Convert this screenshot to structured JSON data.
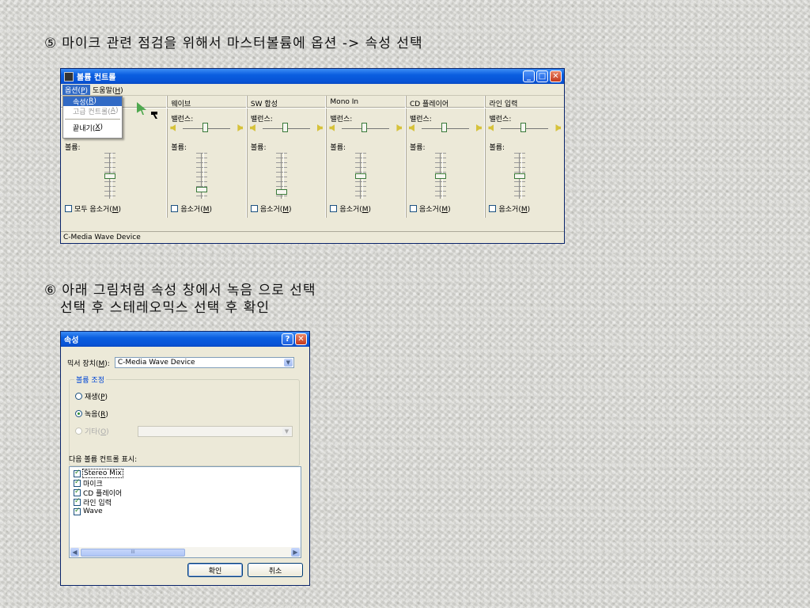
{
  "step5": {
    "number": "⑤",
    "text": "마이크 관련 점검을 위해서 마스터볼륨에 옵션 -> 속성 선택"
  },
  "step6": {
    "number": "⑥",
    "line1": "아래 그림처럼 속성 창에서 녹음 으로 선택",
    "line2": "선택 후 스테레오믹스 선택 후 확인"
  },
  "volume_window": {
    "title": "볼륨 컨트롤",
    "menu": {
      "options": "옵션(",
      "options_key": "P",
      "options_end": ")",
      "help": "도움말(",
      "help_key": "H",
      "help_end": ")"
    },
    "dropdown": {
      "items": [
        {
          "pre": "속성(",
          "key": "R",
          "post": ")"
        },
        {
          "pre": "고급 컨트롤(",
          "key": "A",
          "post": ")"
        },
        {
          "pre": "끝내기(",
          "key": "X",
          "post": ")"
        }
      ]
    },
    "master": {
      "balance": "밸",
      "volume": "볼륨:",
      "mute_pre": "모두 음소거(",
      "mute_key": "M",
      "mute_post": ")",
      "volume_level": 0.5
    },
    "channels": [
      {
        "name": "웨이브",
        "balance": "밸런스:",
        "volume": "볼륨:",
        "mute_pre": "음소거(",
        "mute_key": "M",
        "mute_post": ")",
        "volume_level": 0.15
      },
      {
        "name": "SW 합성",
        "balance": "밸런스:",
        "volume": "볼륨:",
        "mute_pre": "음소거(",
        "mute_key": "M",
        "mute_post": ")",
        "volume_level": 0.1
      },
      {
        "name": "Mono In",
        "balance": "밸런스:",
        "volume": "볼륨:",
        "mute_pre": "음소거(",
        "mute_key": "M",
        "mute_post": ")",
        "volume_level": 0.5
      },
      {
        "name": "CD 플레이어",
        "balance": "밸런스:",
        "volume": "볼륨:",
        "mute_pre": "음소거(",
        "mute_key": "M",
        "mute_post": ")",
        "volume_level": 0.5
      },
      {
        "name": "라인 입력",
        "balance": "밸런스:",
        "volume": "볼륨:",
        "mute_pre": "음소거(",
        "mute_key": "M",
        "mute_post": ")",
        "volume_level": 0.5
      }
    ],
    "status": "C-Media Wave Device"
  },
  "properties_dialog": {
    "title": "속성",
    "help_glyph": "?",
    "mixer_label_pre": "믹서 장치(",
    "mixer_label_key": "M",
    "mixer_label_post": "):",
    "mixer_value": "C-Media Wave Device",
    "group_title": "볼륨 조정",
    "radios": [
      {
        "pre": "재생(",
        "key": "P",
        "post": ")",
        "checked": false,
        "disabled": false
      },
      {
        "pre": "녹음(",
        "key": "R",
        "post": ")",
        "checked": true,
        "disabled": false
      },
      {
        "pre": "기타(",
        "key": "O",
        "post": ")",
        "checked": false,
        "disabled": true
      }
    ],
    "list_label": "다음 볼륨 컨트롤 표시:",
    "list_items": [
      "Stereo Mix",
      "마이크",
      "CD 플레이어",
      "라인 입력",
      "Wave"
    ],
    "scroll_mid": "III",
    "ok": "확인",
    "cancel": "취소"
  },
  "colors": {
    "title_blue": "#0a5ee0",
    "highlight": "#316ac5",
    "dialog_bg": "#ece9d8"
  }
}
